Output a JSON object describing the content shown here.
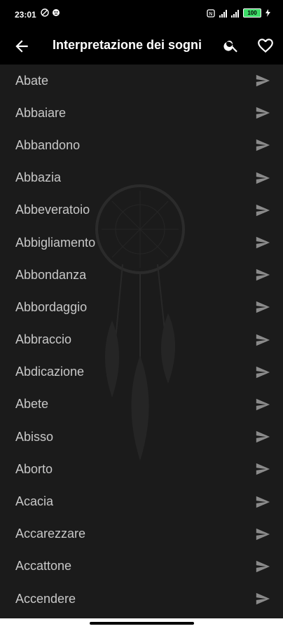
{
  "status_bar": {
    "time": "23:01",
    "battery": "100"
  },
  "toolbar": {
    "title": "Interpretazione dei sogni"
  },
  "words": [
    "Abate",
    "Abbaiare",
    "Abbandono",
    "Abbazia",
    "Abbeveratoio",
    "Abbigliamento",
    "Abbondanza",
    "Abbordaggio",
    "Abbraccio",
    "Abdicazione",
    "Abete",
    "Abisso",
    "Aborto",
    "Acacia",
    "Accarezzare",
    "Accattone",
    "Accendere"
  ],
  "icons": {
    "back": "arrow-left-icon",
    "search": "search-icon",
    "favorite": "heart-icon",
    "open": "send-icon"
  },
  "colors": {
    "background": "#1b1b1b",
    "toolbar": "#000000",
    "text": "#c8c8c8",
    "accent_battery": "#3ddc68"
  }
}
